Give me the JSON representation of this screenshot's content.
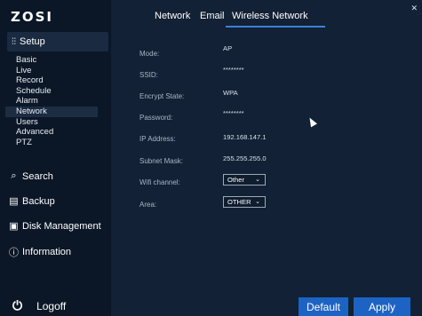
{
  "app": {
    "logo": "ZOSI"
  },
  "sidebar": {
    "setup": {
      "icon": "sliders-icon",
      "label": "Setup"
    },
    "sub_items": [
      {
        "label": "Basic"
      },
      {
        "label": "Live"
      },
      {
        "label": "Record"
      },
      {
        "label": "Schedule"
      },
      {
        "label": "Alarm"
      },
      {
        "label": "Network",
        "active": true
      },
      {
        "label": "Users"
      },
      {
        "label": "Advanced"
      },
      {
        "label": "PTZ"
      }
    ],
    "main_items": [
      {
        "icon": "search-icon",
        "label": "Search"
      },
      {
        "icon": "backup-icon",
        "label": "Backup"
      },
      {
        "icon": "disk-icon",
        "label": "Disk Management"
      },
      {
        "icon": "info-icon",
        "label": "Information"
      }
    ],
    "logoff": {
      "icon": "power-icon",
      "label": "Logoff"
    }
  },
  "tabs": [
    {
      "label": "Network"
    },
    {
      "label": "Email"
    },
    {
      "label": "Wireless Network",
      "active": true
    }
  ],
  "form": {
    "mode": {
      "label": "Mode:",
      "value": "AP"
    },
    "ssid": {
      "label": "SSID:",
      "value": "********"
    },
    "encrypt_state": {
      "label": "Encrypt State:",
      "value": "WPA"
    },
    "password": {
      "label": "Password:",
      "value": "********"
    },
    "ip_address": {
      "label": "IP Address:",
      "value": "192.168.147.1"
    },
    "subnet_mask": {
      "label": "Subnet Mask:",
      "value": "255.255.255.0"
    },
    "wifi_channel": {
      "label": "Wifi channel:",
      "value": "Other"
    },
    "area": {
      "label": "Area:",
      "value": "OTHER"
    }
  },
  "buttons": {
    "default": "Default",
    "apply": "Apply"
  },
  "colors": {
    "accent": "#1d63c3",
    "background": "#122135",
    "sidebar": "#0b1727"
  }
}
